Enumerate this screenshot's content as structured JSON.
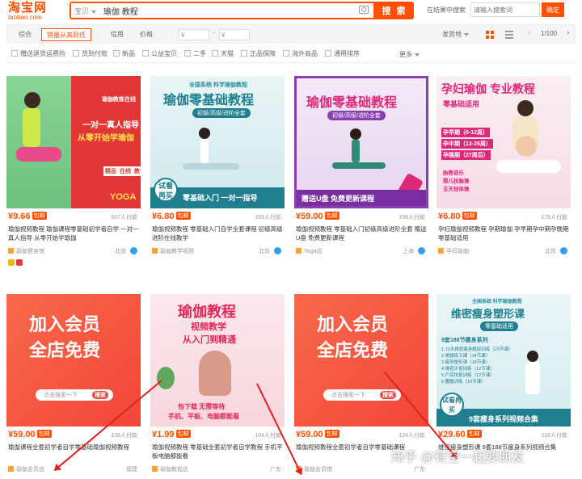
{
  "header": {
    "logo_cn": "淘宝网",
    "logo_en": "taobao.com",
    "search_scope": "宝贝",
    "search_query": "瑜伽 教程",
    "search_button": "搜 索",
    "store_search_label": "在结果中搜索",
    "store_search_placeholder": "请输入搜索词",
    "store_search_button": "确定"
  },
  "sort_bar": {
    "tabs": [
      "综合",
      "销量从高到低",
      "信用",
      "价格"
    ],
    "price_from": "¥",
    "price_to": "¥",
    "ship_from": "发货地",
    "page_indicator": "1/100",
    "prev": "‹",
    "next": "›"
  },
  "filters": [
    "包邮",
    "赠送退货运费险",
    "货到付款",
    "新品",
    "公益宝贝",
    "二手",
    "天猫",
    "正品保障",
    "海外商品",
    "通用排序"
  ],
  "more_filter": "更多",
  "products": [
    {
      "image": {
        "badge": "瑜伽教练在线",
        "l1": "一对一真人指导",
        "l2": "从零开始学瑜伽",
        "tags": [
          "精品",
          "在线",
          "教学"
        ],
        "brand": "YOGA"
      },
      "price": "¥9.66",
      "badge": "包邮",
      "sales": "937人付款",
      "title": "瑜伽视频教程 瑜伽课程零基础初学者自学 一对一真人指导 从零开始学瑜伽",
      "shop": "瑜伽健身馆",
      "location": "北京"
    },
    {
      "image": {
        "top": "全国系统 科学瑜伽教程",
        "l1": "瑜伽零基础教程",
        "sub": "初级/高级/进阶全套",
        "try": "试看再买",
        "bottom": "零基础入门 一对一指导"
      },
      "price": "¥6.80",
      "badge": "包邮",
      "sales": "333人付款",
      "title": "瑜伽视频教程 零基础入门自学全套课程 初级高级进阶在线教学",
      "shop": "瑜伽教学视频",
      "location": "北京"
    },
    {
      "image": {
        "l1": "瑜伽零基础教程",
        "sub": "初级/高级/进阶全套",
        "bottom": "赠送U盘 免费更新课程"
      },
      "price": "¥59.00",
      "badge": "包邮",
      "sales": "198人付款",
      "title": "瑜伽视频教程 零基础入门初级高级进阶全套 赠送U盘 免费更新课程",
      "shop": "Yoga店",
      "location": "上海"
    },
    {
      "image": {
        "l1": "孕妇瑜伽 专业教程",
        "sub": "零基础适用",
        "stages": [
          "孕早期（0-12周）",
          "孕中期（13-26周）",
          "孕晚期（27周后）"
        ],
        "extra": [
          "胎教音乐",
          "婴儿抚触操",
          "五天轻体操"
        ]
      },
      "price": "¥6.80",
      "badge": "包邮",
      "sales": "178人付款",
      "title": "孕妇瑜伽视频教程 孕期瑜伽 孕早期孕中期孕晚期 零基础适用",
      "shop": "孕妈瑜伽",
      "location": "北京"
    },
    {
      "image": {
        "l1": "加入会员",
        "l2": "全店免费",
        "search": "点击搜索一下",
        "go": "搜索"
      },
      "price": "¥59.00",
      "badge": "包邮",
      "sales": "138人付款",
      "title": "瑜伽课程全套初学者自学零基础瑜伽视频教程",
      "shop": "瑜伽会员店",
      "location": "福建"
    },
    {
      "image": {
        "l1": "瑜伽教程",
        "l2": "视频教学",
        "l3": "从入门到精通",
        "bottom1": "包下载 无需等待",
        "bottom2": "手机、平板、电脑都能看"
      },
      "price": "¥1.99",
      "badge": "包邮",
      "sales": "104人付款",
      "title": "瑜伽视频教程 零基础全套初学者自学教程 手机平板电脑都能看",
      "shop": "瑜伽教程店",
      "location": "广东"
    },
    {
      "image": {
        "l1": "加入会员",
        "l2": "全店免费",
        "search": "点击搜索一下",
        "go": "搜索"
      },
      "price": "¥59.00",
      "badge": "包邮",
      "sales": "124人付款",
      "title": "瑜伽视频教程全套初学者自学零基础课程",
      "shop": "瑜伽会员馆",
      "location": "广东"
    },
    {
      "image": {
        "top": "全国系统 科学瑜伽教程",
        "l1": "维密瘦身塑形课",
        "sub": "零基础适用",
        "intro": "9套188节瘦身系列",
        "list": [
          "1.13天维密瘦身腿部训练（23节课）",
          "2.美腿练习课（14节课）",
          "3.瘦身塑形课（18节课）",
          "4.维密天使训练（12节课）",
          "5.产后恢复训练（12节课）",
          "6.腰腹训练（10节课）"
        ],
        "try": "试看再买",
        "bottom": "9套瘦身系列视频合集"
      },
      "price": "¥29.60",
      "badge": "包邮",
      "sales": "116人付款",
      "title": "维密瘦身塑形课 9套188节瘦身系列视频合集",
      "shop": "瘦身课堂",
      "location": "北京"
    }
  ],
  "watermark": "知乎 @有空一起要朋友",
  "colors": {
    "brand": "#ff5000",
    "arrow": "#e02020"
  }
}
